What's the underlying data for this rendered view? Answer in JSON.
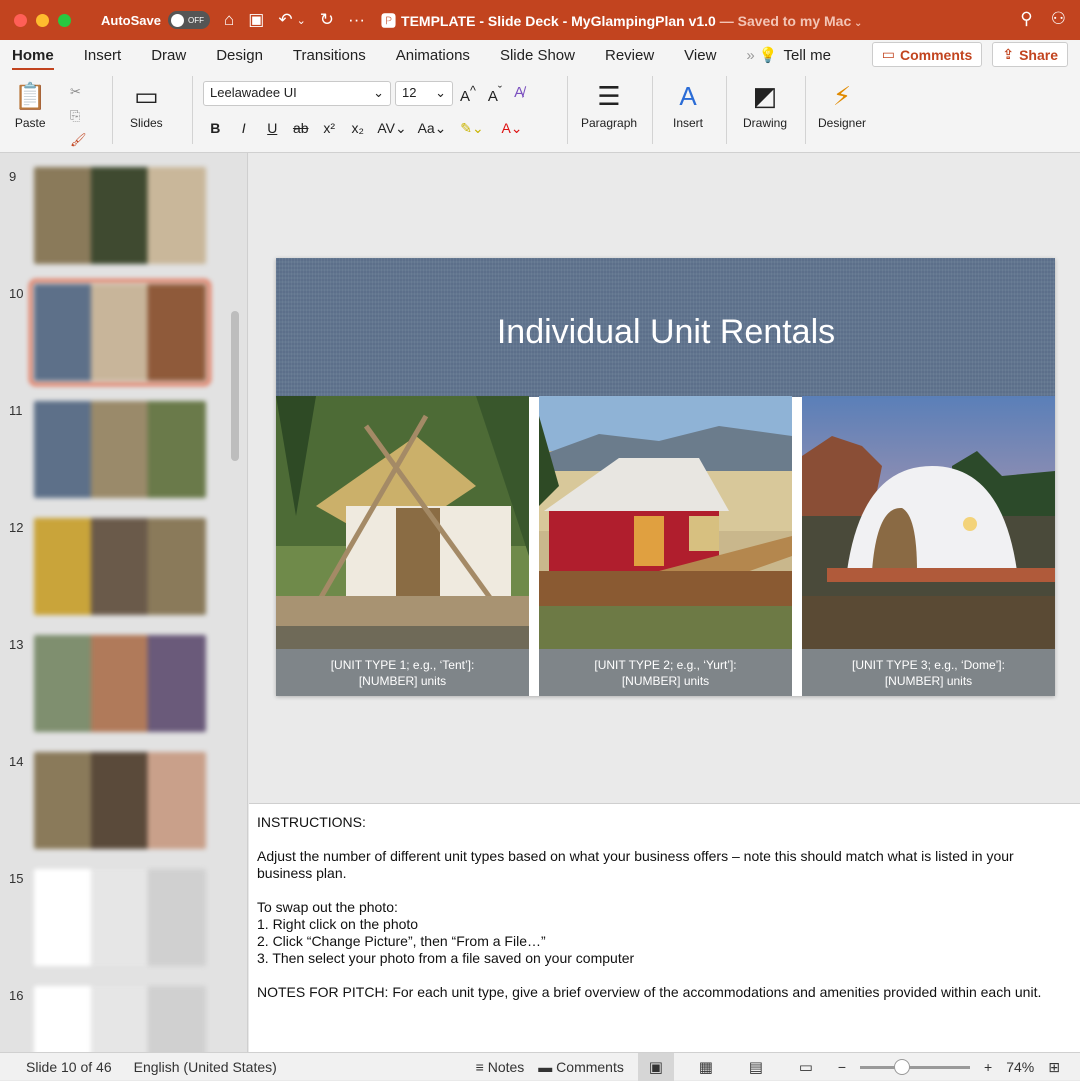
{
  "titlebar": {
    "autosave_label": "AutoSave",
    "autosave_state": "OFF",
    "doc_title": "TEMPLATE - Slide Deck - MyGlampingPlan v1.0",
    "saved_status": "— Saved to my Mac"
  },
  "tabs": [
    "Home",
    "Insert",
    "Draw",
    "Design",
    "Transitions",
    "Animations",
    "Slide Show",
    "Review",
    "View"
  ],
  "tell_me": "Tell me",
  "comments_button": "Comments",
  "share_button": "Share",
  "ribbon": {
    "paste": "Paste",
    "slides": "Slides",
    "font_name": "Leelawadee UI",
    "font_size": "12",
    "paragraph": "Paragraph",
    "insert": "Insert",
    "drawing": "Drawing",
    "designer": "Designer"
  },
  "thumbnails": [
    {
      "num": "9",
      "colors": [
        "#8a7a5a",
        "#3f4a30",
        "#c9b79a"
      ]
    },
    {
      "num": "10",
      "colors": [
        "#5d7089",
        "#c8b59a",
        "#8f5a3a"
      ]
    },
    {
      "num": "11",
      "colors": [
        "#5d7089",
        "#9a8a6a",
        "#6a7a4a"
      ]
    },
    {
      "num": "12",
      "colors": [
        "#c9a43a",
        "#6a5a4a",
        "#8a7a5a"
      ]
    },
    {
      "num": "13",
      "colors": [
        "#7f8f6f",
        "#b07a5a",
        "#6a5a7a"
      ]
    },
    {
      "num": "14",
      "colors": [
        "#8a7a5a",
        "#5a4a3a",
        "#c9a08a"
      ]
    },
    {
      "num": "15",
      "colors": [
        "#ffffff",
        "#e6e6e6",
        "#d0d0d0"
      ]
    },
    {
      "num": "16",
      "colors": [
        "#ffffff",
        "#e6e6e6",
        "#d0d0d0"
      ]
    }
  ],
  "slide": {
    "title": "Individual Unit Rentals",
    "captions": [
      {
        "line1": "[UNIT TYPE 1; e.g., ‘Tent’]:",
        "line2": "[NUMBER] units"
      },
      {
        "line1": "[UNIT TYPE 2; e.g., ‘Yurt’]:",
        "line2": "[NUMBER] units"
      },
      {
        "line1": "[UNIT TYPE 3; e.g., ‘Dome’]:",
        "line2": "[NUMBER] units"
      }
    ]
  },
  "notes": {
    "heading": "INSTRUCTIONS:",
    "para1": "Adjust the number of different unit types based on what your business offers – note this should match what is listed in your business plan.",
    "swap_heading": "To swap out the photo:",
    "steps": [
      "1.  Right click on the photo",
      "2.  Click “Change Picture”, then “From a File…”",
      "3.  Then select your photo from a file saved on your computer"
    ],
    "pitch": "NOTES FOR PITCH: For each unit type, give a brief overview of the accommodations and amenities provided within each unit."
  },
  "status": {
    "slide_info": "Slide 10 of 46",
    "language": "English (United States)",
    "notes": "Notes",
    "comments": "Comments",
    "zoom": "74%"
  }
}
